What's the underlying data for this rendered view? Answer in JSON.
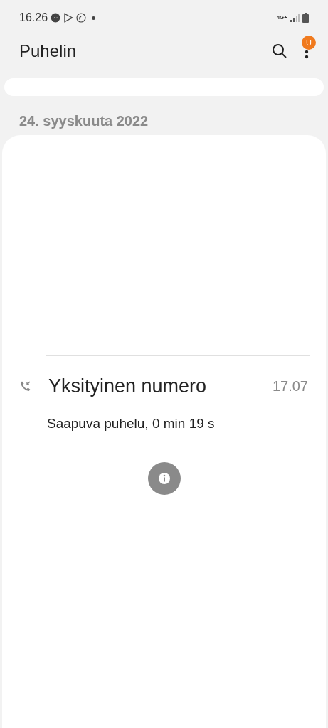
{
  "status_bar": {
    "time": "16.26",
    "network": "4G+"
  },
  "header": {
    "title": "Puhelin",
    "menu_badge": "U"
  },
  "date_heading": "24. syyskuuta 2022",
  "calls": [
    {
      "name": "Yksityinen numero",
      "time": "17.07",
      "detail": "Saapuva puhelu, 0 min 19 s",
      "kind": "incoming",
      "expanded": true
    }
  ]
}
